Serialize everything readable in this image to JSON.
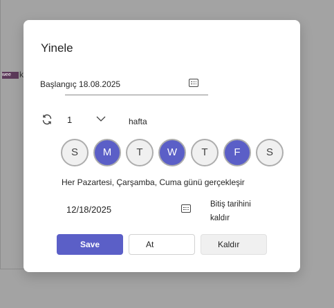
{
  "background": {
    "tag_text": "wee",
    "letter": "k"
  },
  "dialog": {
    "title": "Yinele",
    "start_label": "Başlangıç 18.08.2025",
    "interval_value": "1",
    "interval_unit": "hafta",
    "days": [
      {
        "label": "S",
        "selected": false
      },
      {
        "label": "M",
        "selected": true
      },
      {
        "label": "T",
        "selected": false
      },
      {
        "label": "W",
        "selected": true
      },
      {
        "label": "T",
        "selected": false
      },
      {
        "label": "F",
        "selected": true
      },
      {
        "label": "S",
        "selected": false
      }
    ],
    "summary": "Her Pazartesi, Çarşamba, Cuma günü gerçekleşir",
    "end_date": "12/18/2025",
    "remove_end_label": "Bitiş tarihini kaldır",
    "buttons": {
      "save": "Save",
      "skip": "At",
      "remove": "Kaldır"
    }
  },
  "colors": {
    "accent": "#5b5fc7",
    "overlay": "#a3a3a3"
  }
}
